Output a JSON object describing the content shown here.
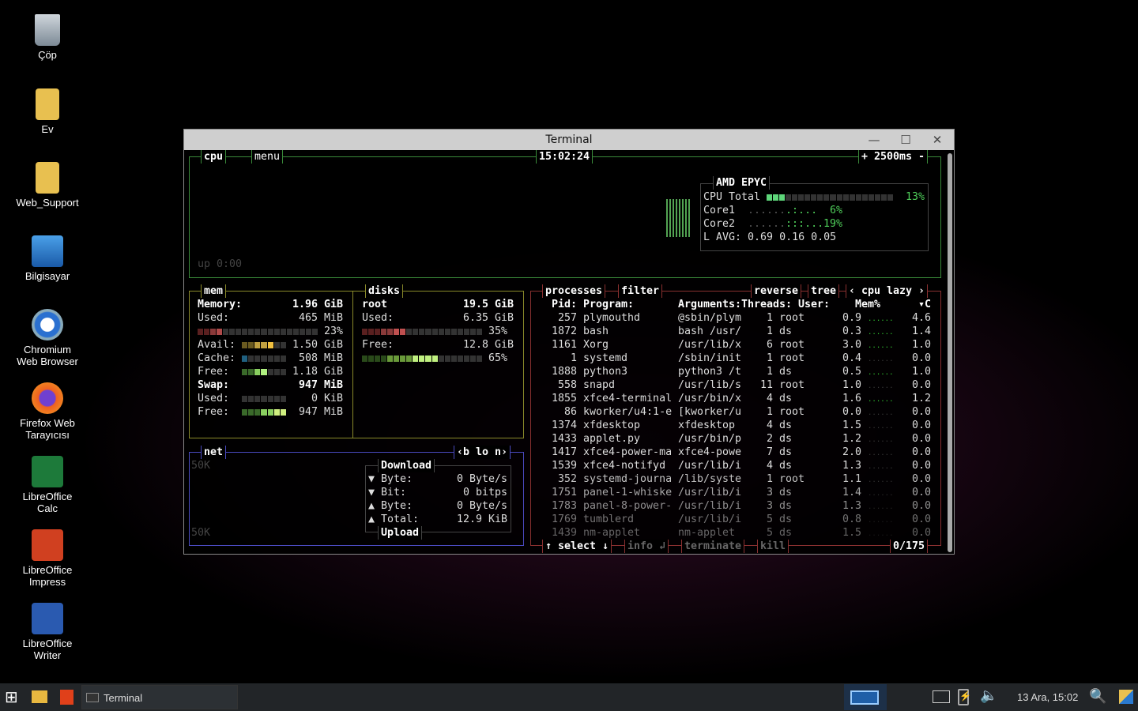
{
  "desktop": {
    "icons": [
      "Çöp",
      "Ev",
      "Web_Support",
      "Bilgisayar",
      "Chromium\nWeb Browser",
      "Firefox Web\nTarayıcısı",
      "LibreOffice\nCalc",
      "LibreOffice\nImpress",
      "LibreOffice\nWriter"
    ]
  },
  "window": {
    "title": "Terminal"
  },
  "cpu": {
    "label": "cpu",
    "menu": "menu",
    "clock": "15:02:24",
    "interval": "+ 2500ms -",
    "uptime": "up 0:00",
    "model": "AMD EPYC",
    "total_label": "CPU Total",
    "total_pct": "13%",
    "total_value": 13,
    "cores": [
      {
        "name": "Core1",
        "pct": "6%"
      },
      {
        "name": "Core2",
        "pct": "19%"
      }
    ],
    "lavg": "L AVG: 0.69 0.16 0.05"
  },
  "mem": {
    "label": "mem",
    "rows": [
      {
        "k": "Memory:",
        "v": "1.96 GiB",
        "bold": true
      },
      {
        "k": "Used:",
        "v": "465 MiB"
      },
      {
        "k": "",
        "v": "23%",
        "pct": 23
      },
      {
        "k": "Avail:",
        "v": "1.50 GiB",
        "pct": 77
      },
      {
        "k": "Cache:",
        "v": "508 MiB",
        "pct": 10
      },
      {
        "k": "Free:",
        "v": "1.18 GiB",
        "pct": 58
      },
      {
        "k": "Swap:",
        "v": "947 MiB",
        "bold": true
      },
      {
        "k": "Used:",
        "v": "0 KiB",
        "pct": 0
      },
      {
        "k": "Free:",
        "v": "947 MiB",
        "pct": 100
      }
    ]
  },
  "disks": {
    "label": "disks",
    "name": "root",
    "size": "19.5 GiB",
    "used_label": "Used:",
    "used": "6.35 GiB",
    "used_pct": "35%",
    "free_label": "Free:",
    "free": "12.8 GiB",
    "free_pct": "65%"
  },
  "net": {
    "label": "net",
    "iface": "‹b lo n›",
    "scale_top": "50K",
    "scale_bottom": "50K",
    "download": "Download",
    "upload": "Upload",
    "rows": [
      {
        "k": "▼ Byte:",
        "v": "0 Byte/s"
      },
      {
        "k": "▼ Bit:",
        "v": "0 bitps"
      },
      {
        "k": "▲ Byte:",
        "v": "0 Byte/s"
      },
      {
        "k": "▲ Total:",
        "v": "12.9 KiB"
      }
    ]
  },
  "proc": {
    "label": "processes",
    "filter": "filter",
    "reverse": "reverse",
    "tree": "tree",
    "sort": "‹ cpu lazy ›",
    "headers": {
      "pid": "Pid:",
      "program": "Program:",
      "args": "Arguments:",
      "threads": "Threads:",
      "user": "User:",
      "mem": "Mem%",
      "cpu": "▾C"
    },
    "rows": [
      [
        "257",
        "plymouthd",
        "@sbin/plym",
        "1",
        "root",
        "0.9",
        "4.6"
      ],
      [
        "1872",
        "bash",
        "bash /usr/",
        "1",
        "ds",
        "0.3",
        "1.4"
      ],
      [
        "1161",
        "Xorg",
        "/usr/lib/x",
        "6",
        "root",
        "3.0",
        "1.0"
      ],
      [
        "1",
        "systemd",
        "/sbin/init",
        "1",
        "root",
        "0.4",
        "0.0"
      ],
      [
        "1888",
        "python3",
        "python3 /t",
        "1",
        "ds",
        "0.5",
        "1.0"
      ],
      [
        "558",
        "snapd",
        "/usr/lib/s",
        "11",
        "root",
        "1.0",
        "0.0"
      ],
      [
        "1855",
        "xfce4-terminal",
        "/usr/bin/x",
        "4",
        "ds",
        "1.6",
        "1.2"
      ],
      [
        "86",
        "kworker/u4:1-e",
        "[kworker/u",
        "1",
        "root",
        "0.0",
        "0.0"
      ],
      [
        "1374",
        "xfdesktop",
        "xfdesktop",
        "4",
        "ds",
        "1.5",
        "0.0"
      ],
      [
        "1433",
        "applet.py",
        "/usr/bin/p",
        "2",
        "ds",
        "1.2",
        "0.0"
      ],
      [
        "1417",
        "xfce4-power-ma",
        "xfce4-powe",
        "7",
        "ds",
        "2.0",
        "0.0"
      ],
      [
        "1539",
        "xfce4-notifyd",
        "/usr/lib/i",
        "4",
        "ds",
        "1.3",
        "0.0"
      ],
      [
        "352",
        "systemd-journa",
        "/lib/syste",
        "1",
        "root",
        "1.1",
        "0.0"
      ],
      [
        "1751",
        "panel-1-whiske",
        "/usr/lib/i",
        "3",
        "ds",
        "1.4",
        "0.0"
      ],
      [
        "1783",
        "panel-8-power-",
        "/usr/lib/i",
        "3",
        "ds",
        "1.3",
        "0.0"
      ],
      [
        "1769",
        "tumblerd",
        "/usr/lib/i",
        "5",
        "ds",
        "0.8",
        "0.0"
      ],
      [
        "1439",
        "nm-applet",
        "nm-applet",
        "5",
        "ds",
        "1.5",
        "0.0"
      ]
    ],
    "select": "↑ select ↓",
    "info": "info ↲",
    "terminate": "terminate",
    "kill": "kill",
    "count": "0/175"
  },
  "taskbar": {
    "task": "Terminal",
    "clock": "13 Ara, 15:02"
  },
  "colors": {
    "cpu_box": "#3a8a3a",
    "mem_box": "#8a8a2a",
    "net_box": "#4a4ac0",
    "proc_box": "#8a3030"
  }
}
